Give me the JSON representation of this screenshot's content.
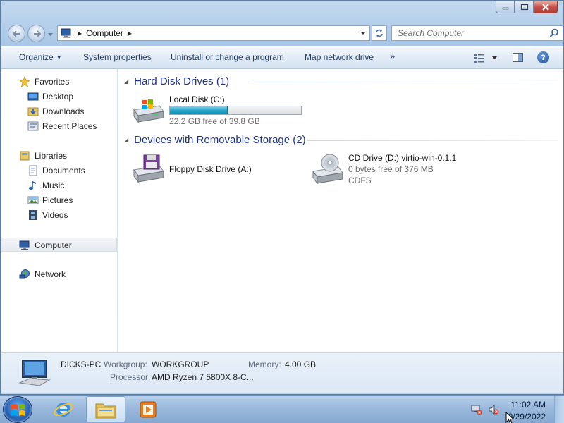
{
  "window": {
    "address": {
      "crumb": "Computer"
    },
    "search": {
      "placeholder": "Search Computer"
    }
  },
  "toolbar": {
    "organize": "Organize",
    "system_properties": "System properties",
    "uninstall": "Uninstall or change a program",
    "map_drive": "Map network drive",
    "more": "»"
  },
  "navpane": {
    "favorites": "Favorites",
    "desktop": "Desktop",
    "downloads": "Downloads",
    "recent": "Recent Places",
    "libraries": "Libraries",
    "documents": "Documents",
    "music": "Music",
    "pictures": "Pictures",
    "videos": "Videos",
    "computer": "Computer",
    "network": "Network"
  },
  "content": {
    "hdd_group": "Hard Disk Drives (1)",
    "removable_group": "Devices with Removable Storage (2)",
    "drives": [
      {
        "name": "Local Disk (C:)",
        "free": "22.2 GB free of 39.8 GB",
        "used_fraction": 0.44
      },
      {
        "name": "Floppy Disk Drive (A:)"
      },
      {
        "name": "CD Drive (D:) virtio-win-0.1.1",
        "free": "0 bytes free of 376 MB",
        "fs": "CDFS"
      }
    ]
  },
  "details": {
    "pc_name": "DICKS-PC",
    "workgroup_label": "Workgroup:",
    "workgroup": "WORKGROUP",
    "memory_label": "Memory:",
    "memory": "4.00 GB",
    "processor_label": "Processor:",
    "processor": "AMD Ryzen 7 5800X 8-C..."
  },
  "taskbar": {
    "time": "11:02 AM",
    "date": "9/29/2022"
  },
  "colors": {
    "progress_fill": "#1b9bc4",
    "group_header": "#1e3287"
  }
}
